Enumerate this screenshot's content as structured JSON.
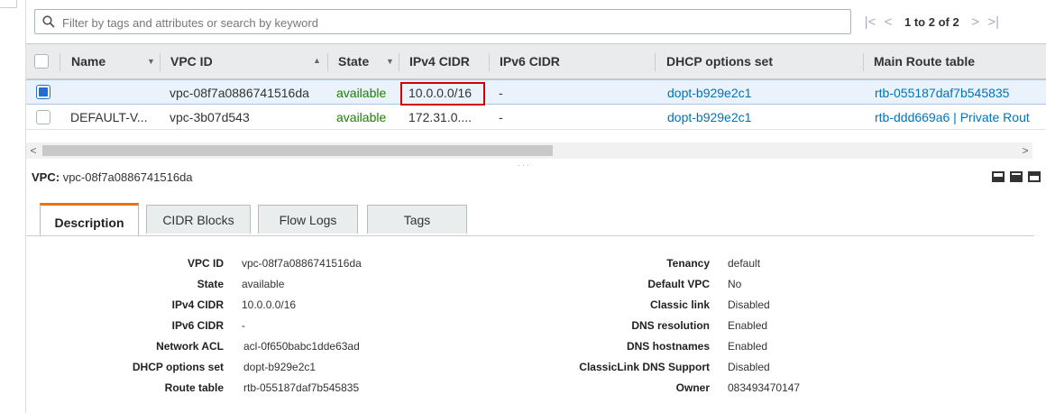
{
  "search": {
    "placeholder": "Filter by tags and attributes or search by keyword"
  },
  "pagination": {
    "text": "1 to 2 of 2",
    "first": "|<",
    "prev": "<",
    "next": ">",
    "last": ">|"
  },
  "table": {
    "columns": [
      "Name",
      "VPC ID",
      "State",
      "IPv4 CIDR",
      "IPv6 CIDR",
      "DHCP options set",
      "Main Route table"
    ],
    "rows": [
      {
        "name": "",
        "vpc_id": "vpc-08f7a0886741516da",
        "state": "available",
        "ipv4": "10.0.0.0/16",
        "ipv6": "-",
        "dhcp": "dopt-b929e2c1",
        "route": "rtb-055187daf7b545835",
        "selected": true
      },
      {
        "name": "DEFAULT-V...",
        "vpc_id": "vpc-3b07d543",
        "state": "available",
        "ipv4": "172.31.0....",
        "ipv6": "-",
        "dhcp": "dopt-b929e2c1",
        "route": "rtb-ddd669a6 | Private Rout",
        "selected": false
      }
    ]
  },
  "detail": {
    "vpc_label": "VPC:",
    "vpc_value": "vpc-08f7a0886741516da",
    "tabs": [
      "Description",
      "CIDR Blocks",
      "Flow Logs",
      "Tags"
    ],
    "left": [
      {
        "label": "VPC ID",
        "value": "vpc-08f7a0886741516da"
      },
      {
        "label": "State",
        "value": "available"
      },
      {
        "label": "IPv4 CIDR",
        "value": "10.0.0.0/16"
      },
      {
        "label": "IPv6 CIDR",
        "value": "-"
      },
      {
        "label": "Network ACL",
        "value": "acl-0f650babc1dde63ad"
      },
      {
        "label": "DHCP options set",
        "value": "dopt-b929e2c1"
      },
      {
        "label": "Route table",
        "value": "rtb-055187daf7b545835"
      }
    ],
    "right": [
      {
        "label": "Tenancy",
        "value": "default"
      },
      {
        "label": "Default VPC",
        "value": "No"
      },
      {
        "label": "Classic link",
        "value": "Disabled"
      },
      {
        "label": "DNS resolution",
        "value": "Enabled"
      },
      {
        "label": "DNS hostnames",
        "value": "Enabled"
      },
      {
        "label": "ClassicLink DNS Support",
        "value": "Disabled"
      },
      {
        "label": "Owner",
        "value": "083493470147"
      }
    ]
  },
  "colors": {
    "accent": "#ec7211",
    "link": "#0073bb",
    "status_green": "#1d8102",
    "highlight": "#d20000"
  },
  "icons": {
    "search": "search-icon",
    "grip": "resize-grip-icon"
  }
}
